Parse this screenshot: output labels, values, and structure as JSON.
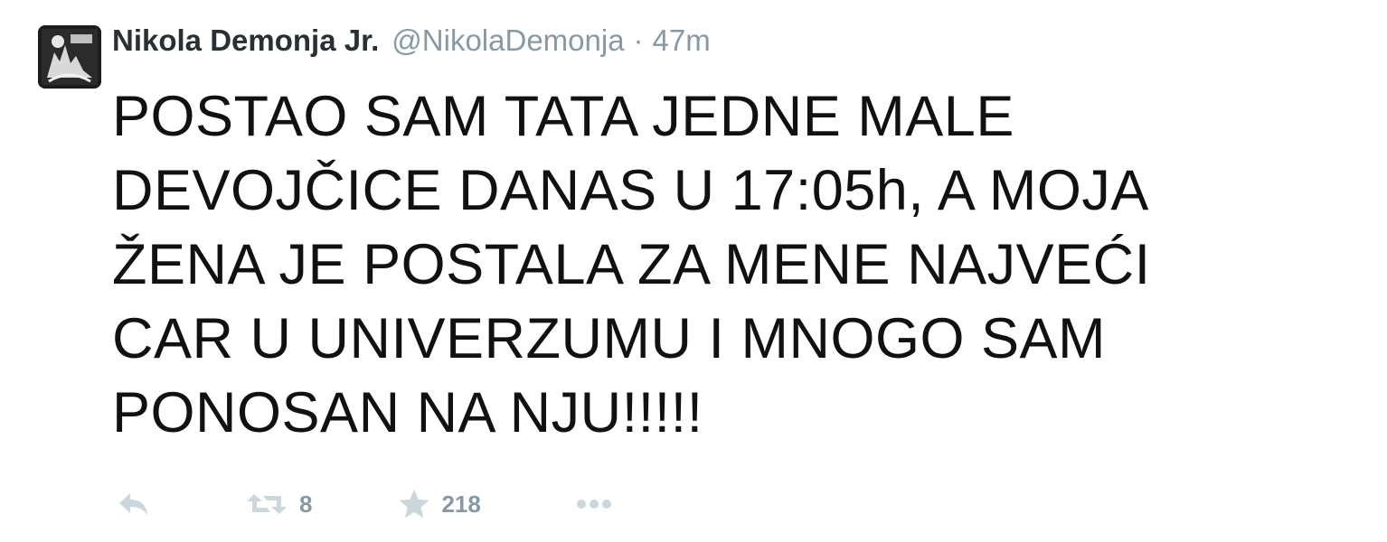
{
  "tweet": {
    "fullname": "Nikola Demonja Jr.",
    "username": "@NikolaDemonja",
    "separator": "·",
    "time": "47m",
    "text_lines": [
      "POSTAO SAM TATA JEDNE MALE",
      "DEVOJČICE DANAS U 17:05h, A MOJA",
      "ŽENA JE POSTALA ZA MENE NAJVEĆI",
      "CAR U UNIVERZUMU I MNOGO SAM",
      "PONOSAN NA NJU!!!!!"
    ]
  },
  "actions": {
    "reply_icon": "reply-icon",
    "retweet_icon": "retweet-icon",
    "retweet_count": "8",
    "favorite_icon": "star-icon",
    "favorite_count": "218",
    "more_icon": "more-icon"
  },
  "colors": {
    "icon_gray": "#ccd6dd",
    "meta_gray": "#8899a6",
    "text": "#111111"
  }
}
